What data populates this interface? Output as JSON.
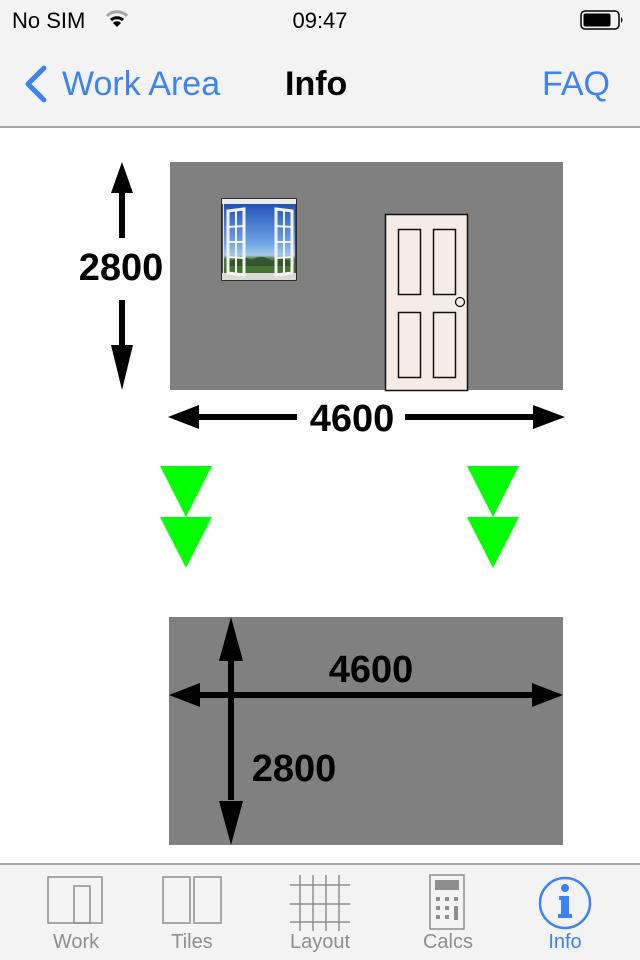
{
  "status_bar": {
    "carrier": "No SIM",
    "wifi_icon": "wifi-icon",
    "time": "09:47",
    "battery_icon": "battery-icon",
    "battery_level": 0.8
  },
  "nav": {
    "back_label": "Work Area",
    "back_icon": "chevron-left-icon",
    "title": "Info",
    "right_label": "FAQ"
  },
  "diagram": {
    "wall_color": "#808080",
    "arrow_color": "#00ff00",
    "door_color": "#f5ece6",
    "wall_view": {
      "height_label": "2800",
      "width_label": "4600",
      "features": [
        "window-image",
        "door-icon"
      ]
    },
    "floor_view": {
      "width_label": "4600",
      "height_label": "2800"
    }
  },
  "tab_bar": {
    "active_color": "#3e82f7",
    "inactive_color": "#8e8e8e",
    "tabs": [
      {
        "label": "Work",
        "icon": "work-area-icon",
        "active": false
      },
      {
        "label": "Tiles",
        "icon": "tiles-icon",
        "active": false
      },
      {
        "label": "Layout",
        "icon": "grid-layout-icon",
        "active": false
      },
      {
        "label": "Calcs",
        "icon": "calculator-icon",
        "active": false
      },
      {
        "label": "Info",
        "icon": "info-icon",
        "active": true
      }
    ]
  }
}
